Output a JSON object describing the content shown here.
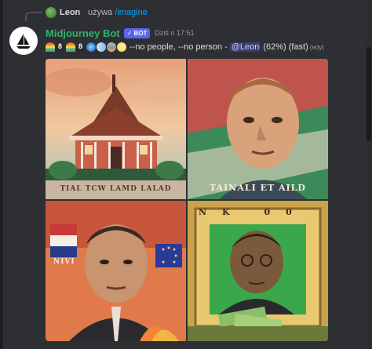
{
  "reply": {
    "user": "Leon",
    "action": "używa",
    "command": "/imagine"
  },
  "message": {
    "author": "Midjourney Bot",
    "badge": "✓ BOT",
    "timestamp": "Dziś o 17:51",
    "prompt_suffix": "--no people, --no person -",
    "mention": "@Leon",
    "progress": "(62%)",
    "mode": "(fast)",
    "edited": "(edyt"
  },
  "images": [
    {
      "caption": "TIAL TCW LAMD LALAD"
    },
    {
      "caption": "TAINALI ET AILD"
    },
    {
      "caption": "NIVI"
    },
    {
      "caption": "NK 00"
    }
  ],
  "colors": {
    "background": "#2e2f33",
    "bot_name": "#2fb36b",
    "badge": "#5865f2",
    "command_link": "#00a8fc",
    "mention_text": "#c9cdfb"
  }
}
